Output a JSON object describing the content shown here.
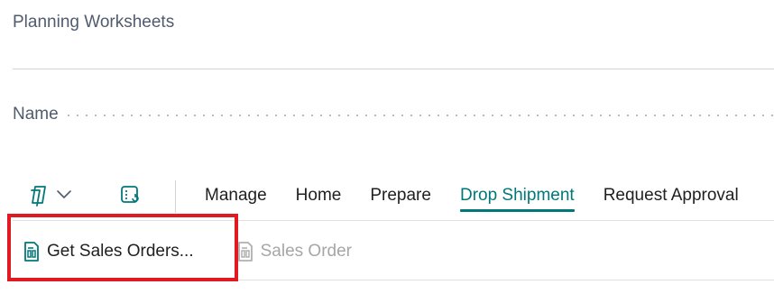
{
  "page": {
    "title": "Planning Worksheets"
  },
  "fields": {
    "name_label": "Name"
  },
  "actionbar": {
    "pages_icon": "pages-icon",
    "edit_icon": "edit-list-icon",
    "tabs": [
      {
        "label": "Manage",
        "active": false
      },
      {
        "label": "Home",
        "active": false
      },
      {
        "label": "Prepare",
        "active": false
      },
      {
        "label": "Drop Shipment",
        "active": true
      },
      {
        "label": "Request Approval",
        "active": false
      }
    ],
    "accent_color": "#00787a"
  },
  "commands": {
    "get_sales_orders": {
      "label": "Get Sales Orders...",
      "icon": "document-icon",
      "enabled": true
    },
    "sales_order": {
      "label": "Sales Order",
      "icon": "document-icon",
      "enabled": false
    }
  },
  "highlight": {
    "color": "#e11a22"
  }
}
